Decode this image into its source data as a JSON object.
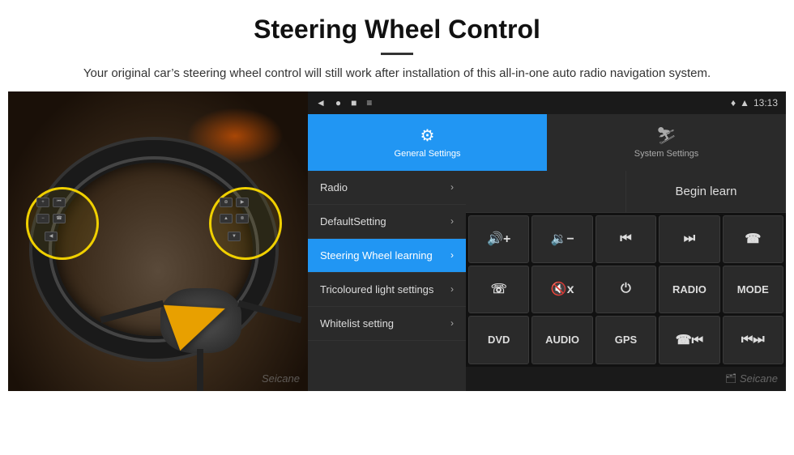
{
  "header": {
    "title": "Steering Wheel Control",
    "subtitle": "Your original car’s steering wheel control will still work after installation of this all-in-one auto radio navigation system."
  },
  "status_bar": {
    "time": "13:13",
    "icons": [
      "◄",
      "●",
      "■",
      "≡"
    ]
  },
  "tabs": [
    {
      "label": "General Settings",
      "active": true,
      "icon": "⚙"
    },
    {
      "label": "System Settings",
      "active": false,
      "icon": "⛷"
    }
  ],
  "menu_items": [
    {
      "label": "Radio",
      "active": false
    },
    {
      "label": "DefaultSetting",
      "active": false
    },
    {
      "label": "Steering Wheel learning",
      "active": true
    },
    {
      "label": "Tricoloured light settings",
      "active": false
    },
    {
      "label": "Whitelist setting",
      "active": false
    }
  ],
  "begin_learn_label": "Begin learn",
  "control_buttons": [
    [
      "🔊+",
      "🔊−",
      "⏮",
      "⏭",
      "☎"
    ],
    [
      "☎",
      "🔇 x",
      "⏻",
      "RADIO",
      "MODE"
    ],
    [
      "DVD",
      "AUDIO",
      "GPS",
      "☎⏮",
      "⏮⏭"
    ]
  ],
  "seicane_label": "Seicane"
}
